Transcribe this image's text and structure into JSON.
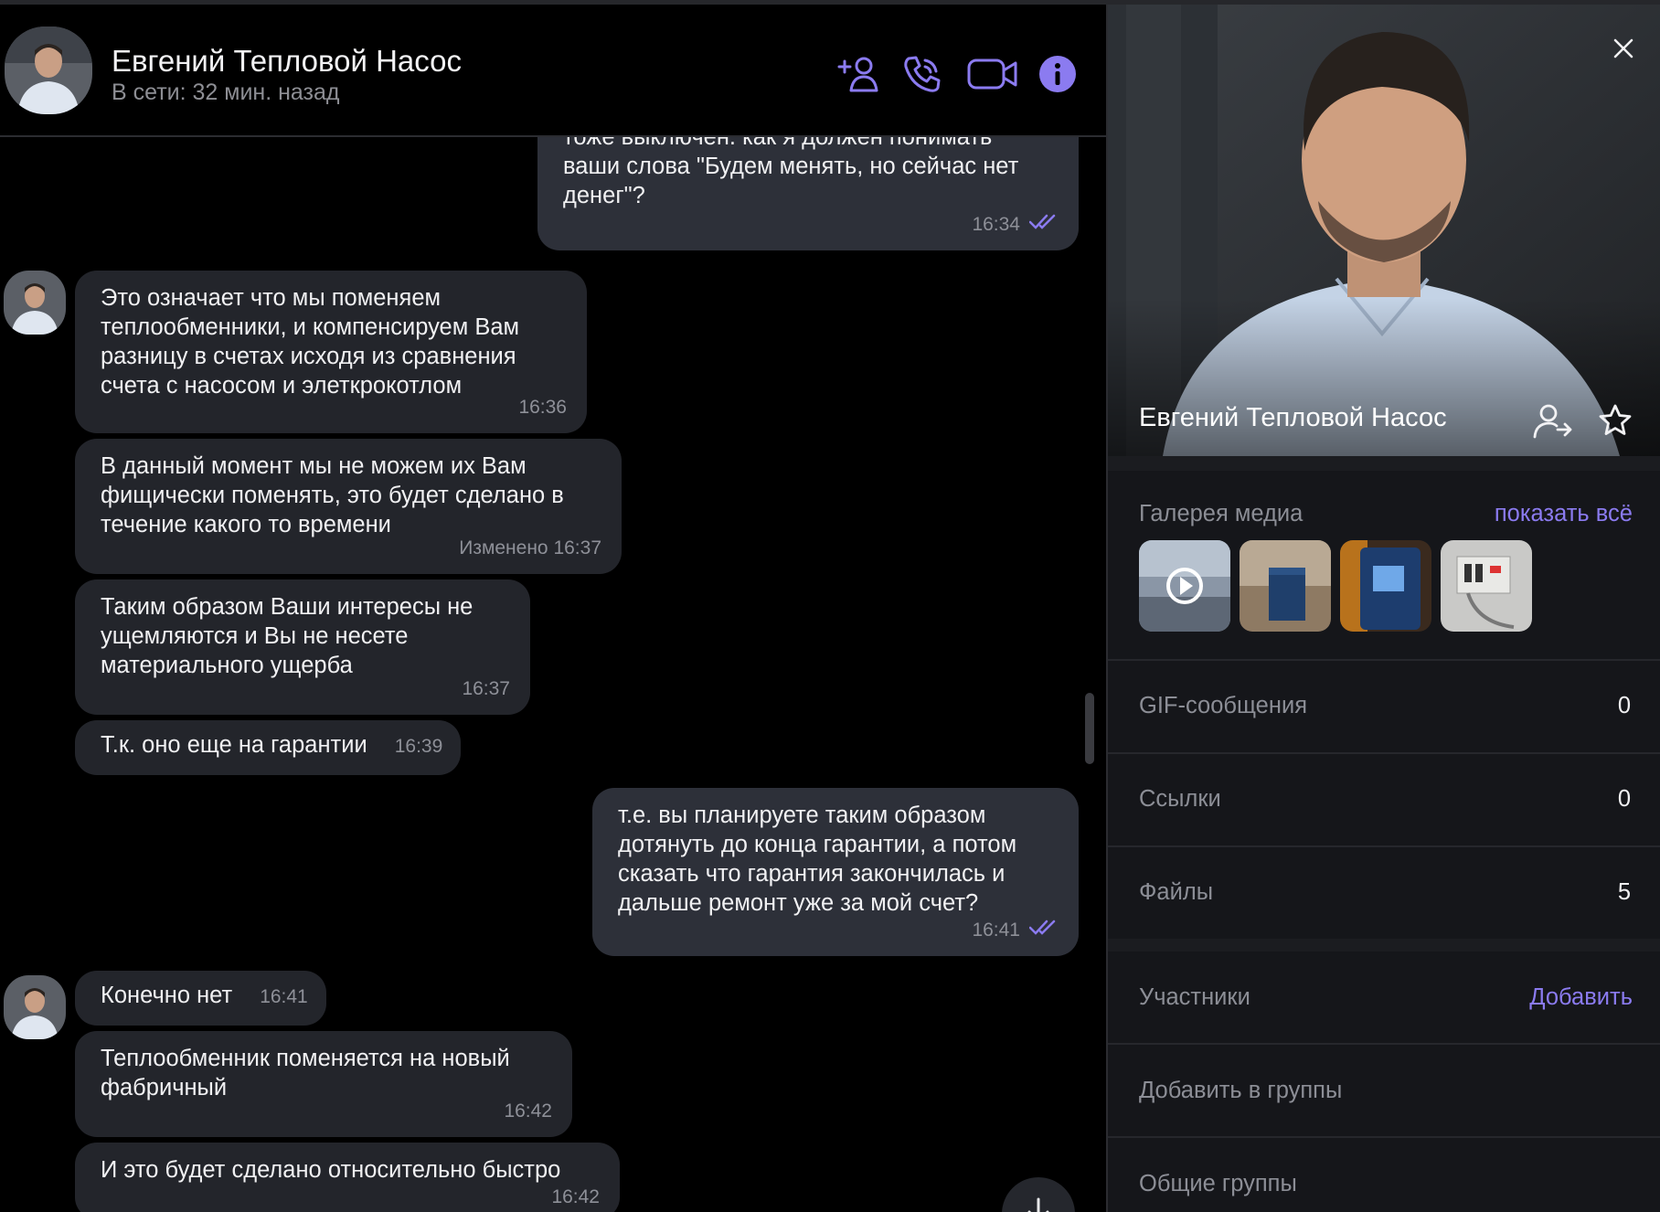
{
  "header": {
    "contact_name": "Евгений Тепловой Насос",
    "status": "В сети: 32 мин. назад"
  },
  "icons": {
    "add_contact": "add-user-icon",
    "call": "phone-icon",
    "video": "video-camera-icon",
    "info": "info-icon",
    "close": "close-icon",
    "share": "share-contact-icon",
    "favorite": "star-icon",
    "play": "play-icon",
    "scroll_down": "arrow-down-icon",
    "read": "double-check-icon"
  },
  "messages": [
    {
      "dir": "out",
      "text": "тоже выключен. как я должен понимать ваши слова \"Будем менять, но сейчас нет денег\"?",
      "time": "16:34",
      "read": true
    },
    {
      "dir": "in",
      "text": "Это означает что мы поменяем теплообменники, и компенсируем Вам разницу в счетах исходя из сравнения счета с насосом и элеткрокотлом",
      "time": "16:36"
    },
    {
      "dir": "in",
      "text": "В данный момент мы не можем их Вам фищически поменять, это будет сделано в течение какого то времени",
      "time": "Изменено 16:37"
    },
    {
      "dir": "in",
      "text": "Таким образом Ваши интересы не ущемляются и Вы не несете материального ущерба",
      "time": "16:37"
    },
    {
      "dir": "in",
      "text": "Т.к. оно еще на гарантии",
      "time": "16:39"
    },
    {
      "dir": "out",
      "text": "т.е. вы планируете таким образом дотянуть до конца гарантии, а потом сказать что гарантия закончилась и дальше ремонт уже за мой счет?",
      "time": "16:41",
      "read": true
    },
    {
      "dir": "in",
      "text": "Конечно нет",
      "time": "16:41"
    },
    {
      "dir": "in",
      "text": "Теплообменник поменяется на новый фабричный",
      "time": "16:42"
    },
    {
      "dir": "in",
      "text": "И это будет сделано относительно быстро",
      "time": "16:42"
    }
  ],
  "panel": {
    "profile_name": "Евгений Тепловой Насос",
    "media_gallery_label": "Галерея медиа",
    "show_all_label": "показать всё",
    "gif_label": "GIF-сообщения",
    "gif_count": "0",
    "links_label": "Ссылки",
    "links_count": "0",
    "files_label": "Файлы",
    "files_count": "5",
    "members_label": "Участники",
    "add_label": "Добавить",
    "add_to_groups_label": "Добавить в группы",
    "common_groups_label": "Общие группы"
  },
  "colors": {
    "accent": "#8b7bf0",
    "incoming_bubble": "#23252b",
    "outgoing_bubble": "#2d3039",
    "panel_bg": "#15161a"
  }
}
